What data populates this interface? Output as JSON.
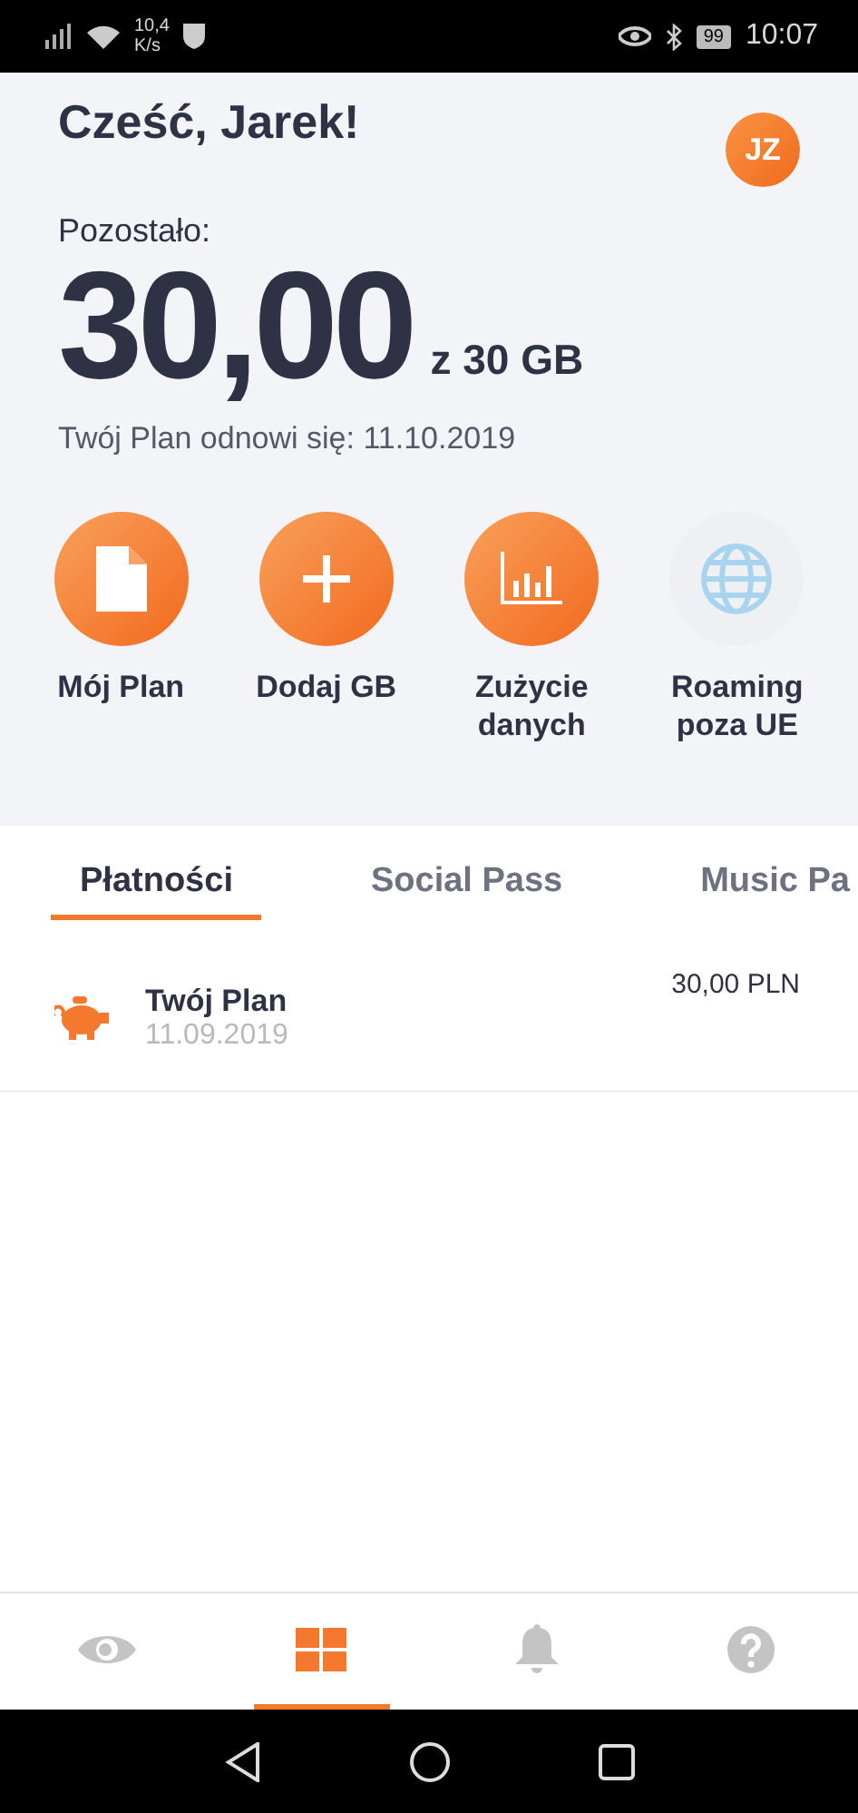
{
  "status_bar": {
    "speed_value": "10,4",
    "speed_unit": "K/s",
    "battery": "99",
    "time": "10:07"
  },
  "header": {
    "greeting": "Cześć, Jarek!",
    "avatar": "JZ",
    "remaining_label": "Pozostało:",
    "remaining": "30,00",
    "total": "z 30 GB",
    "renewal": "Twój Plan odnowi się: 11.10.2019"
  },
  "actions": [
    {
      "kind": "document",
      "label": "Mój Plan",
      "highlighted": true
    },
    {
      "kind": "plus",
      "label": "Dodaj GB",
      "highlighted": true
    },
    {
      "kind": "chart",
      "label": "Zużycie danych",
      "highlighted": true
    },
    {
      "kind": "globe",
      "label": "Roaming poza UE",
      "highlighted": false
    }
  ],
  "tabs": [
    {
      "label": "Płatności",
      "selected": true
    },
    {
      "label": "Social Pass",
      "selected": false
    },
    {
      "label": "Music Pa",
      "selected": false
    }
  ],
  "payments": [
    {
      "title": "Twój Plan",
      "date": "11.09.2019",
      "amount": "30,00 PLN"
    }
  ],
  "bottom_nav": [
    {
      "kind": "eye",
      "selected": false
    },
    {
      "kind": "grid",
      "selected": true
    },
    {
      "kind": "bell",
      "selected": false
    },
    {
      "kind": "help",
      "selected": false
    }
  ]
}
